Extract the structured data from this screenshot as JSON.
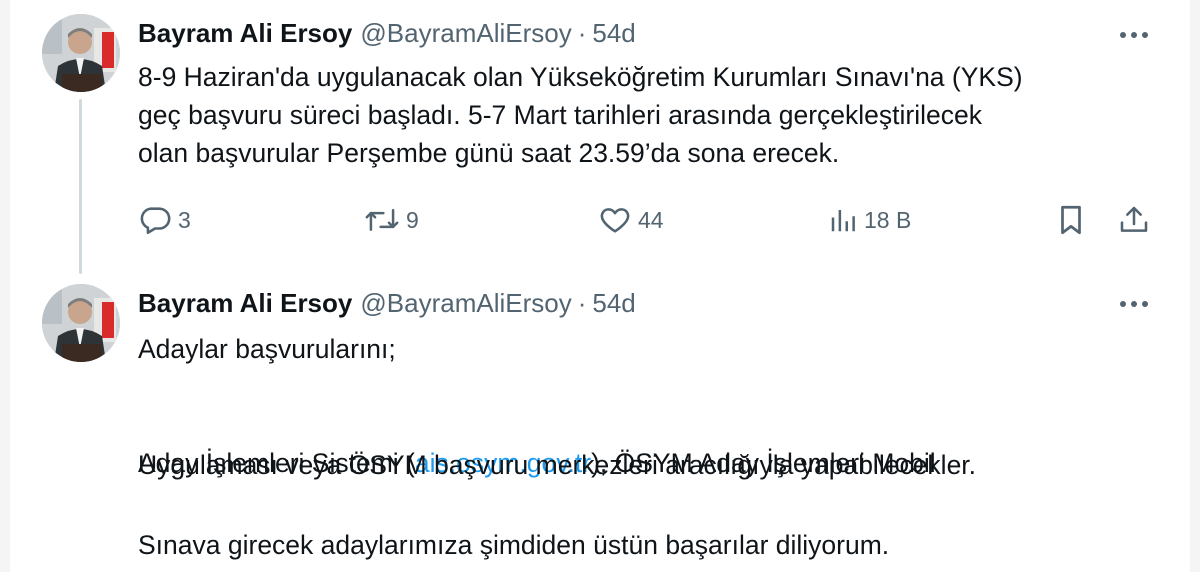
{
  "tweets": [
    {
      "author_name": "Bayram Ali Ersoy",
      "handle": "@BayramAliErsoy",
      "separator": "·",
      "time": "54d",
      "text": "8-9 Haziran'da uygulanacak olan Yükseköğretim Kurumları Sınavı'na (YKS)\ngeç başvuru süreci başladı. 5-7 Mart tarihleri arasında gerçekleştirilecek\nolan başvurular Perşembe günü saat 23.59’da sona erecek.",
      "actions": {
        "replies": "3",
        "reposts": "9",
        "likes": "44",
        "views": "18 B"
      }
    },
    {
      "author_name": "Bayram Ali Ersoy",
      "handle": "@BayramAliErsoy",
      "separator": "·",
      "time": "54d",
      "line1": "Adaylar başvurularını;",
      "line2_before": "Aday İşlemleri Sistemi (",
      "link": "ais.osym.gov.tr",
      "line2_after": "), ÖSYM Aday İşlemleri Mobil",
      "line3": "Uygulaması veya ÖSYM başvuru merkezleri aracılığıyla yapabilecekler.",
      "line4": "Sınava girecek adaylarımıza şimdiden üstün başarılar diliyorum."
    }
  ],
  "icons": {
    "reply": "comment-icon",
    "repost": "repost-icon",
    "like": "heart-icon",
    "views": "analytics-icon",
    "bookmark": "bookmark-icon",
    "share": "share-icon",
    "more": "more-icon"
  },
  "colors": {
    "text": "#0f1419",
    "secondary": "#536471",
    "link": "#1d9bf0",
    "thread_line": "#cfd9de"
  }
}
